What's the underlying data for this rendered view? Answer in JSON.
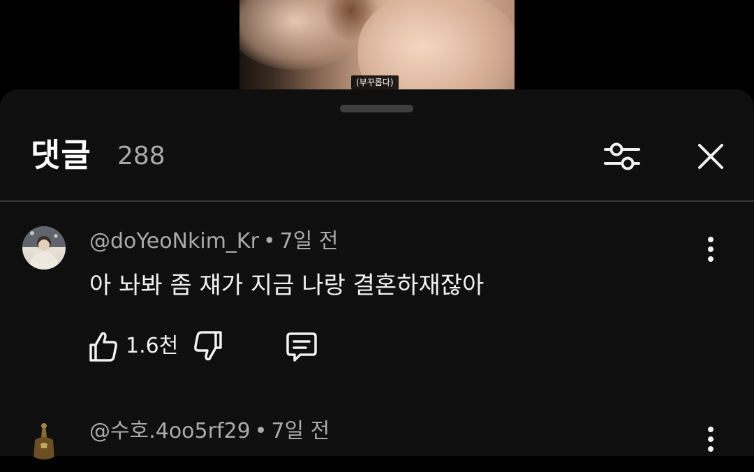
{
  "video": {
    "caption": "(부꾸롭다)"
  },
  "comments_panel": {
    "title": "댓글",
    "count": "288",
    "filter_icon": "sliders-icon",
    "close_icon": "close-icon"
  },
  "comments": [
    {
      "author": "@doYeoNkim_Kr",
      "separator": "•",
      "time": "7일 전",
      "text": "아 놔봐 좀 쟤가 지금 나랑 결혼하재잖아",
      "likes": "1.6천"
    },
    {
      "author": "@수호.4oo5rf29",
      "separator": "•",
      "time": "7일 전"
    }
  ],
  "colors": {
    "sheet_bg": "#0f0f0f",
    "primary_text": "#f1f1f1",
    "secondary_text": "#aaaaaa"
  }
}
